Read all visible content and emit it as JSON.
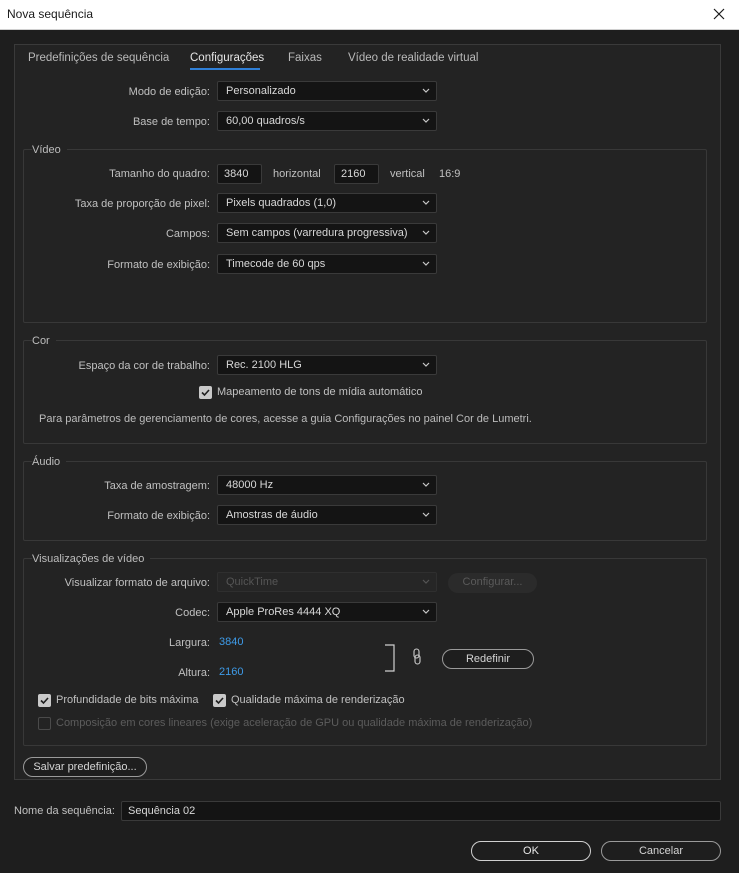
{
  "window": {
    "title": "Nova sequência"
  },
  "tabs": [
    "Predefinições de sequência",
    "Configurações",
    "Faixas",
    "Vídeo de realidade virtual"
  ],
  "general": {
    "edit_mode_label": "Modo de edição:",
    "edit_mode_value": "Personalizado",
    "timebase_label": "Base de tempo:",
    "timebase_value": "60,00  quadros/s"
  },
  "video": {
    "title": "Vídeo",
    "frame_size_label": "Tamanho do quadro:",
    "frame_width": "3840",
    "horizontal_label": "horizontal",
    "frame_height": "2160",
    "vertical_label": "vertical",
    "aspect": "16:9",
    "pixel_ratio_label": "Taxa de proporção de pixel:",
    "pixel_ratio_value": "Pixels quadrados (1,0)",
    "fields_label": "Campos:",
    "fields_value": "Sem campos (varredura progressiva)",
    "display_format_label": "Formato de exibição:",
    "display_format_value": "Timecode de 60 qps"
  },
  "color": {
    "title": "Cor",
    "working_space_label": "Espaço da cor de trabalho:",
    "working_space_value": "Rec. 2100 HLG",
    "auto_tone_map_label": "Mapeamento de tons de mídia automático",
    "auto_tone_map_checked": true,
    "note": "Para parâmetros de gerenciamento de cores, acesse a guia Configurações no painel Cor de Lumetri."
  },
  "audio": {
    "title": "Áudio",
    "sample_rate_label": "Taxa de amostragem:",
    "sample_rate_value": "48000 Hz",
    "display_format_label": "Formato de exibição:",
    "display_format_value": "Amostras de áudio"
  },
  "previews": {
    "title": "Visualizações de vídeo",
    "file_format_label": "Visualizar formato de arquivo:",
    "file_format_value": "QuickTime",
    "configure_label": "Configurar...",
    "codec_label": "Codec:",
    "codec_value": "Apple ProRes 4444 XQ",
    "width_label": "Largura:",
    "width_value": "3840",
    "height_label": "Altura:",
    "height_value": "2160",
    "reset_label": "Redefinir",
    "max_bit_depth_label": "Profundidade de bits máxima",
    "max_bit_depth_checked": true,
    "max_render_quality_label": "Qualidade máxima de renderização",
    "max_render_quality_checked": true,
    "linear_comp_label": "Composição em cores lineares (exige aceleração de GPU ou qualidade máxima de renderização)",
    "linear_comp_checked": false
  },
  "save_preset_label": "Salvar predefinição...",
  "sequence_name_label": "Nome da sequência:",
  "sequence_name_value": "Sequência 02",
  "ok_label": "OK",
  "cancel_label": "Cancelar"
}
